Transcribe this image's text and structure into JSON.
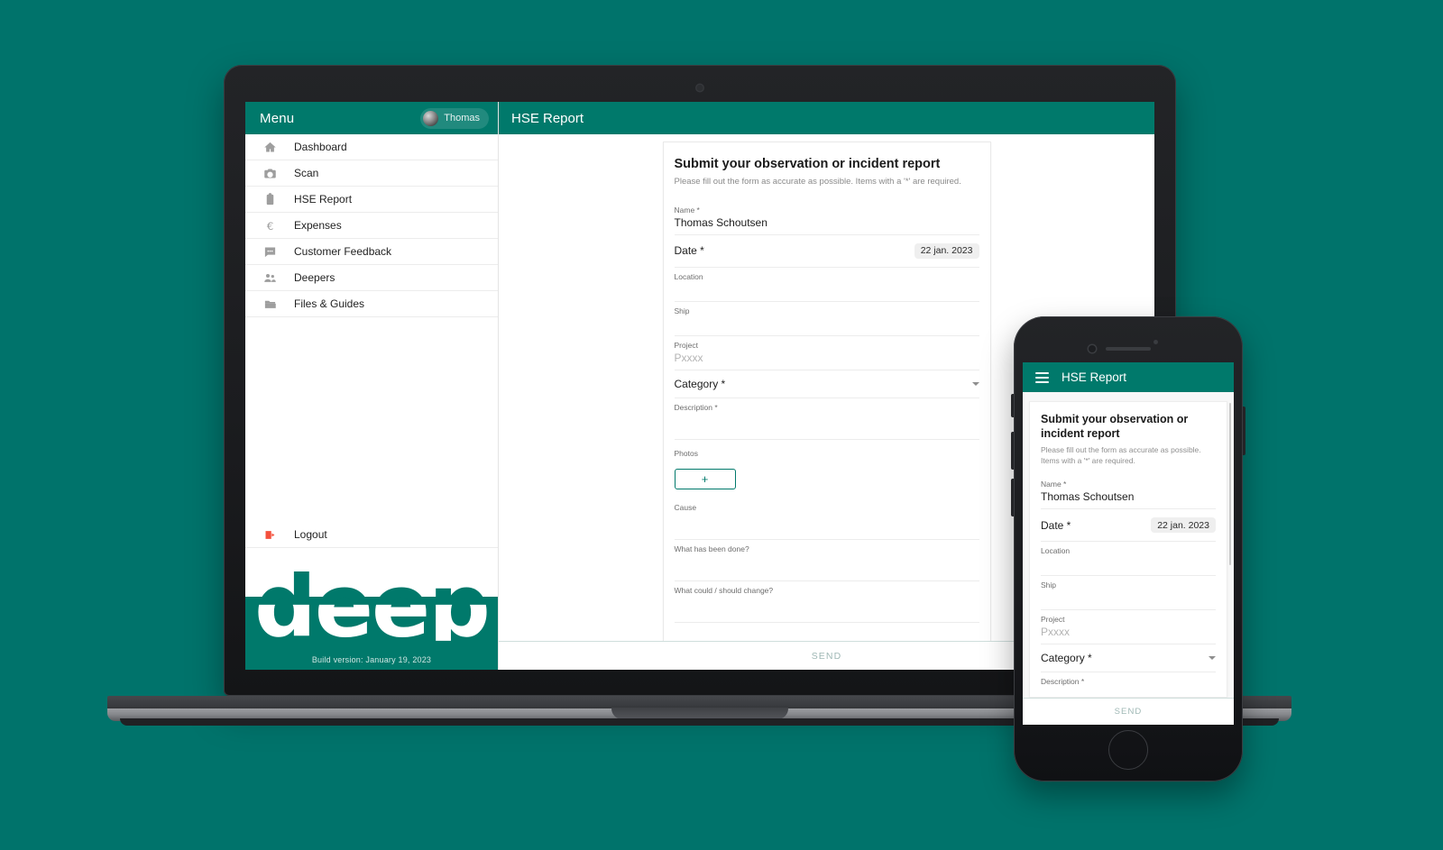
{
  "brand": {
    "word": "deep",
    "accent_color": "#00796b",
    "background_color": "#00736b"
  },
  "desktop": {
    "sidebar": {
      "menu_label": "Menu",
      "user": {
        "name": "Thomas",
        "avatar_icon": "user-avatar-photo"
      },
      "items": [
        {
          "label": "Dashboard",
          "icon": "home-icon"
        },
        {
          "label": "Scan",
          "icon": "camera-icon"
        },
        {
          "label": "HSE Report",
          "icon": "clipboard-icon"
        },
        {
          "label": "Expenses",
          "icon": "euro-icon"
        },
        {
          "label": "Customer Feedback",
          "icon": "chat-bubble-icon"
        },
        {
          "label": "Deepers",
          "icon": "people-icon"
        },
        {
          "label": "Files & Guides",
          "icon": "folder-icon"
        }
      ],
      "logout": {
        "label": "Logout",
        "icon": "logout-icon"
      },
      "build_version": "Build version: January 19, 2023"
    },
    "topbar": {
      "title": "HSE Report"
    },
    "form": {
      "heading": "Submit your observation or incident report",
      "subheading": "Please fill out the form as accurate as possible. Items with a '*' are required.",
      "fields": {
        "name": {
          "label": "Name *",
          "value": "Thomas Schoutsen"
        },
        "date": {
          "label": "Date *",
          "value": "22 jan. 2023"
        },
        "location": {
          "label": "Location",
          "value": ""
        },
        "ship": {
          "label": "Ship",
          "value": ""
        },
        "project": {
          "label": "Project",
          "placeholder": "Pxxxx"
        },
        "category": {
          "label": "Category *",
          "value": ""
        },
        "description": {
          "label": "Description *",
          "value": ""
        },
        "photos": {
          "label": "Photos",
          "add_button": "+"
        },
        "cause": {
          "label": "Cause",
          "value": ""
        },
        "what_done": {
          "label": "What has been done?",
          "value": ""
        },
        "what_change": {
          "label": "What could / should change?",
          "value": ""
        }
      },
      "send_label": "SEND"
    }
  },
  "mobile": {
    "topbar": {
      "title": "HSE Report",
      "menu_icon": "hamburger-icon"
    },
    "form": {
      "heading": "Submit your observation or incident report",
      "subheading": "Please fill out the form as accurate as possible. Items with a '*' are required.",
      "fields": {
        "name": {
          "label": "Name *",
          "value": "Thomas Schoutsen"
        },
        "date": {
          "label": "Date *",
          "value": "22 jan. 2023"
        },
        "location": {
          "label": "Location",
          "value": ""
        },
        "ship": {
          "label": "Ship",
          "value": ""
        },
        "project": {
          "label": "Project",
          "placeholder": "Pxxxx"
        },
        "category": {
          "label": "Category *",
          "value": ""
        },
        "description": {
          "label": "Description *",
          "value": ""
        }
      },
      "send_label": "SEND"
    }
  }
}
